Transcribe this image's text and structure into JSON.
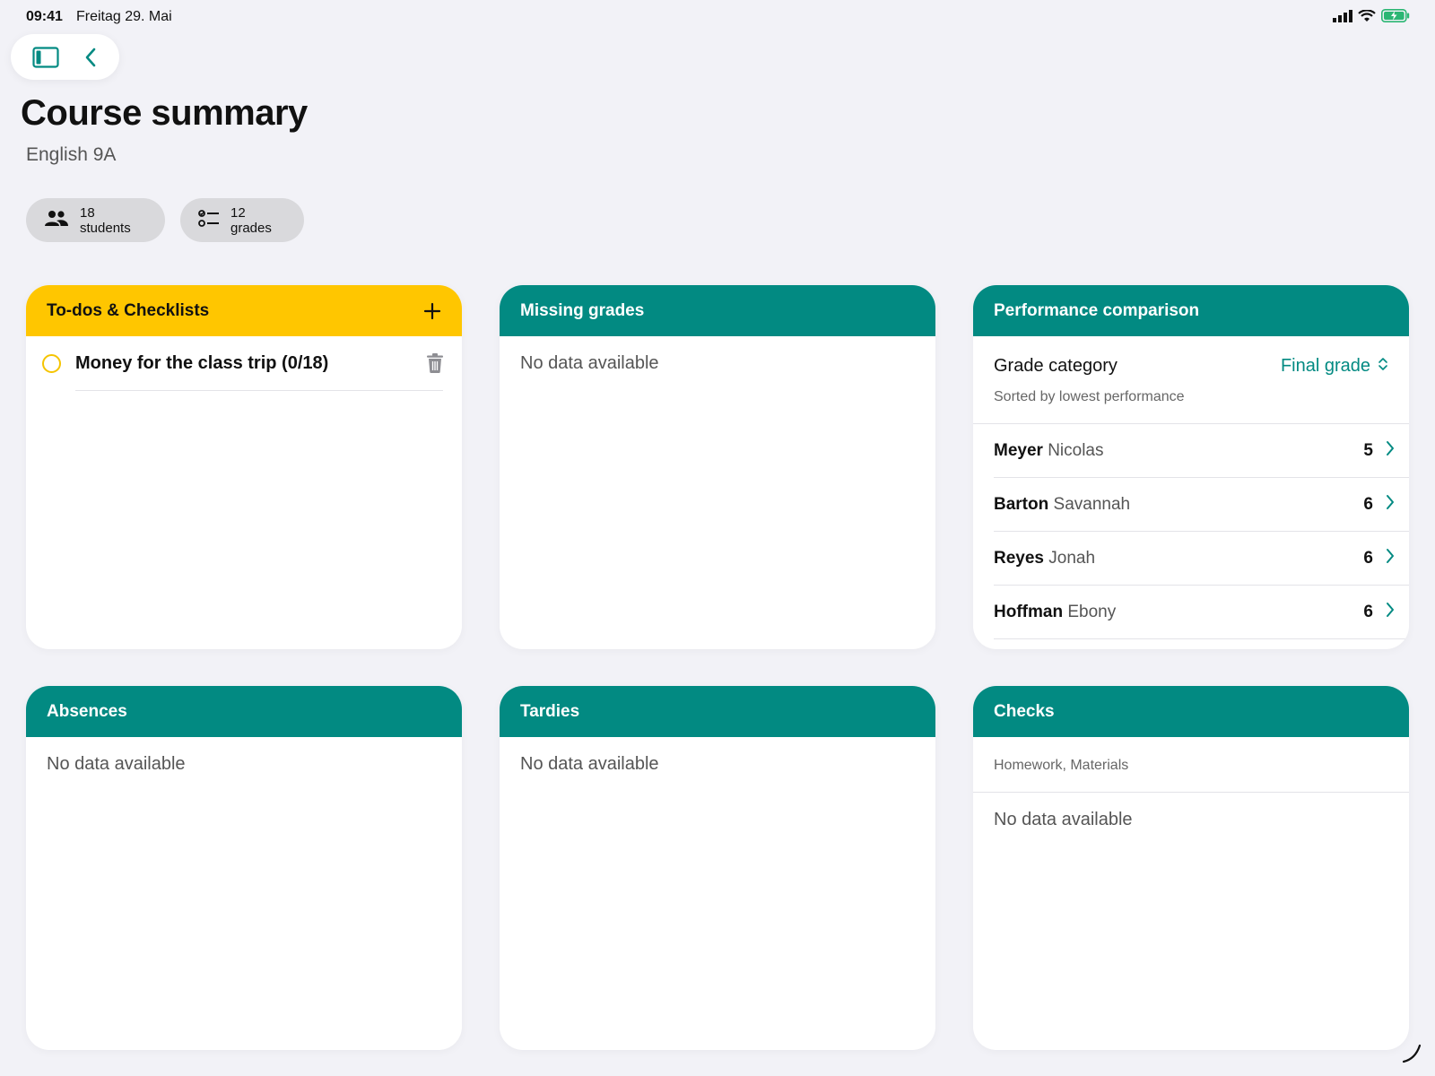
{
  "statusbar": {
    "time": "09:41",
    "date": "Freitag 29. Mai"
  },
  "header": {
    "title": "Course summary",
    "subtitle": "English 9A"
  },
  "chips": {
    "students": "18 students",
    "grades": "12 grades"
  },
  "todos": {
    "title": "To-dos & Checklists",
    "items": [
      {
        "label": "Money for the class trip (0/18)"
      }
    ]
  },
  "missing_grades": {
    "title": "Missing grades",
    "empty": "No data available"
  },
  "performance": {
    "title": "Performance comparison",
    "category_label": "Grade category",
    "category_value": "Final grade",
    "sorted_label": "Sorted by lowest performance",
    "rows": [
      {
        "last": "Meyer",
        "first": "Nicolas",
        "value": "5"
      },
      {
        "last": "Barton",
        "first": "Savannah",
        "value": "6"
      },
      {
        "last": "Reyes",
        "first": "Jonah",
        "value": "6"
      },
      {
        "last": "Hoffman",
        "first": "Ebony",
        "value": "6"
      }
    ]
  },
  "absences": {
    "title": "Absences",
    "empty": "No data available"
  },
  "tardies": {
    "title": "Tardies",
    "empty": "No data available"
  },
  "checks": {
    "title": "Checks",
    "subtitle": "Homework, Materials",
    "empty": "No data available"
  },
  "colors": {
    "accent": "#028a82",
    "todo_header": "#ffc600",
    "background": "#f2f2f7"
  },
  "icons": [
    "sidebar-icon",
    "chevron-left-icon",
    "people-icon",
    "checklist-icon",
    "plus-icon",
    "trash-icon",
    "chevron-right-icon",
    "sort-updown-icon",
    "signal-icon",
    "wifi-icon",
    "battery-icon"
  ]
}
